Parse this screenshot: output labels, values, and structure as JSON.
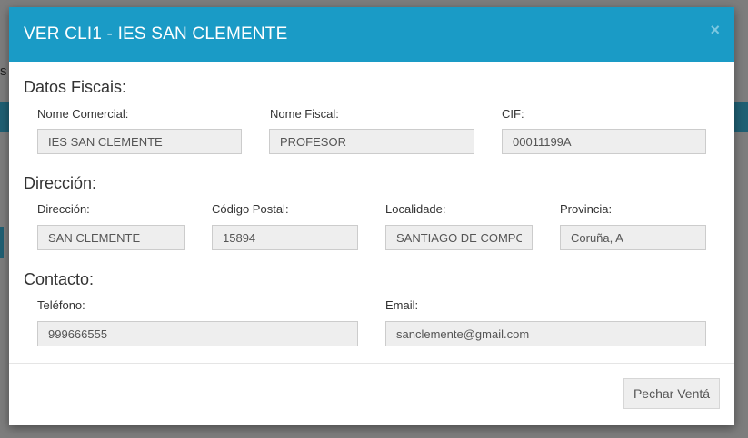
{
  "background": {
    "partial_text": "s"
  },
  "modal": {
    "title": "VER CLI1 - IES SAN CLEMENTE",
    "close_symbol": "×"
  },
  "sections": {
    "fiscal": {
      "title": "Datos Fiscais:",
      "nome_comercial": {
        "label": "Nome Comercial:",
        "value": "IES SAN CLEMENTE"
      },
      "nome_fiscal": {
        "label": "Nome Fiscal:",
        "value": "PROFESOR"
      },
      "cif": {
        "label": "CIF:",
        "value": "00011199A"
      }
    },
    "direccion": {
      "title": "Dirección:",
      "direccion": {
        "label": "Dirección:",
        "value": "SAN CLEMENTE"
      },
      "codigo_postal": {
        "label": "Código Postal:",
        "value": "15894"
      },
      "localidade": {
        "label": "Localidade:",
        "value": "SANTIAGO DE COMPOSTELA"
      },
      "provincia": {
        "label": "Provincia:",
        "value": "Coruña, A"
      }
    },
    "contacto": {
      "title": "Contacto:",
      "telefono": {
        "label": "Teléfono:",
        "value": "999666555"
      },
      "email": {
        "label": "Email:",
        "value": "sanclemente@gmail.com"
      }
    }
  },
  "footer": {
    "close_button_label": "Pechar Ventá"
  },
  "colors": {
    "header": "#1a9bc6",
    "background_bar": "#1f5f73"
  }
}
